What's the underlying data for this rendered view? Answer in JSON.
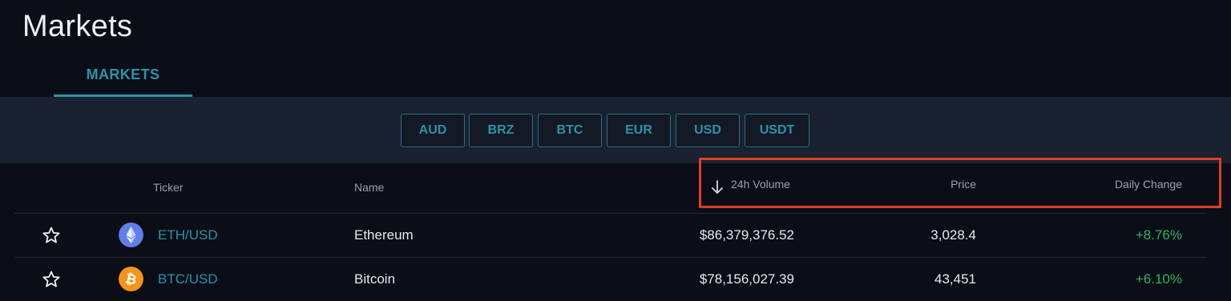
{
  "page": {
    "title": "Markets"
  },
  "tabs": [
    {
      "label": "MARKETS",
      "active": true
    }
  ],
  "quote_filters": [
    "AUD",
    "BRZ",
    "BTC",
    "EUR",
    "USD",
    "USDT"
  ],
  "table": {
    "columns": {
      "ticker": "Ticker",
      "name": "Name",
      "volume": "24h Volume",
      "price": "Price",
      "change": "Daily Change"
    },
    "sort": {
      "column": "24h Volume",
      "direction": "descending",
      "icon": "arrow-down-icon"
    },
    "rows": [
      {
        "ticker": "ETH/USD",
        "name": "Ethereum",
        "volume": "$86,379,376.52",
        "price": "3,028.4",
        "change": "+8.76%",
        "icon": "ethereum-icon"
      },
      {
        "ticker": "BTC/USD",
        "name": "Bitcoin",
        "volume": "$78,156,027.39",
        "price": "43,451",
        "change": "+6.10%",
        "icon": "bitcoin-icon"
      }
    ]
  },
  "colors": {
    "accent": "#2a93a9",
    "positive": "#2fb35b",
    "highlight": "#e13d26",
    "ethereum": "#627eea",
    "bitcoin": "#f7931a"
  }
}
